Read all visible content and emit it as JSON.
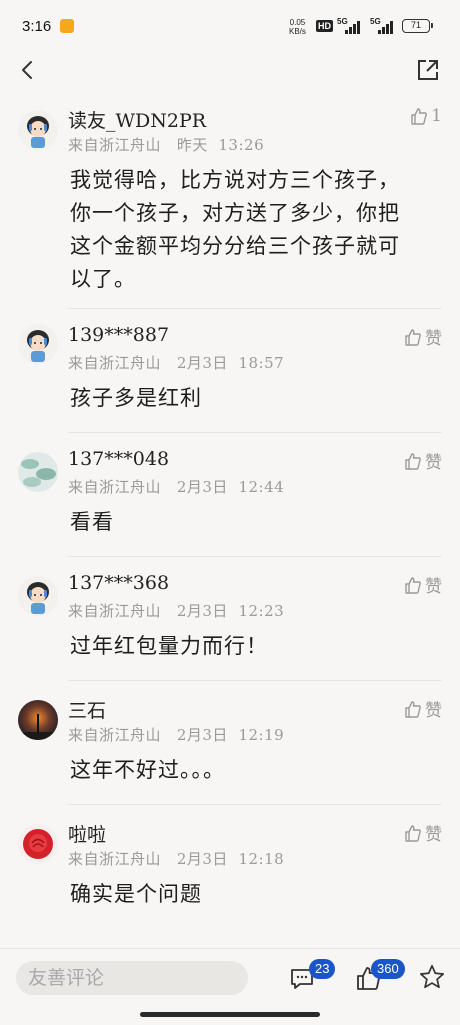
{
  "status": {
    "time": "3:16",
    "speed_value": "0.05",
    "speed_unit": "KB/s",
    "hd": "HD",
    "net1": "5G",
    "net2": "5G",
    "battery": "71"
  },
  "header": {
    "back_icon": "chevron-left-icon",
    "share_icon": "share-icon"
  },
  "comments": [
    {
      "username": "读友_WDN2PR",
      "location": "来自浙江舟山",
      "date": "昨天",
      "time": "13:26",
      "likes": "1",
      "content": "我觉得哈，比方说对方三个孩子，你一个孩子，对方送了多少，你把这个金额平均分分给三个孩子就可以了。"
    },
    {
      "username": "139***887",
      "location": "来自浙江舟山",
      "date": "2月3日",
      "time": "18:57",
      "likes": "赞",
      "content": "孩子多是红利"
    },
    {
      "username": "137***048",
      "location": "来自浙江舟山",
      "date": "2月3日",
      "time": "12:44",
      "likes": "赞",
      "content": "看看"
    },
    {
      "username": "137***368",
      "location": "来自浙江舟山",
      "date": "2月3日",
      "time": "12:23",
      "likes": "赞",
      "content": "过年红包量力而行！"
    },
    {
      "username": "三石",
      "location": "来自浙江舟山",
      "date": "2月3日",
      "time": "12:19",
      "likes": "赞",
      "content": "这年不好过。。。"
    },
    {
      "username": "啦啦",
      "location": "来自浙江舟山",
      "date": "2月3日",
      "time": "12:18",
      "likes": "赞",
      "content": "确实是个问题"
    }
  ],
  "bottom": {
    "input_placeholder": "友善评论",
    "comment_count": "23",
    "like_count": "360",
    "favorite_icon": "star-icon"
  },
  "colors": {
    "background": "#f7f6f4",
    "badge": "#1b56c6",
    "meta_text": "#9a9a9a"
  }
}
